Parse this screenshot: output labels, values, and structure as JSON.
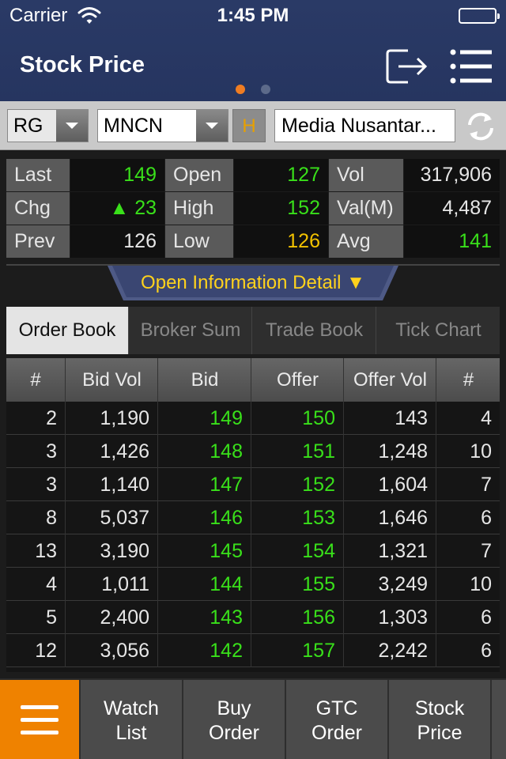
{
  "status_bar": {
    "carrier": "Carrier",
    "time": "1:45 PM"
  },
  "header": {
    "title": "Stock Price",
    "logout_icon": "logout-icon",
    "menu_icon": "list-menu-icon"
  },
  "page_indicator": {
    "active_color": "#f07d22",
    "inactive_color": "#5c6a8a"
  },
  "selector": {
    "board": "RG",
    "stock_code": "MNCN",
    "h_label": "H",
    "stock_name": "Media Nusantar...",
    "refresh_icon": "refresh-icon"
  },
  "quote": {
    "last_label": "Last",
    "last_value": "149",
    "chg_label": "Chg",
    "chg_value": "▲ 23",
    "prev_label": "Prev",
    "prev_value": "126",
    "open_label": "Open",
    "open_value": "127",
    "high_label": "High",
    "high_value": "152",
    "low_label": "Low",
    "low_value": "126",
    "vol_label": "Vol",
    "vol_value": "317,906",
    "valm_label": "Val(M)",
    "valm_value": "4,487",
    "avg_label": "Avg",
    "avg_value": "141"
  },
  "info_toggle": {
    "label": "Open Information Detail ▼"
  },
  "tabs": [
    {
      "label": "Order Book",
      "active": true
    },
    {
      "label": "Broker Sum",
      "active": false
    },
    {
      "label": "Trade Book",
      "active": false
    },
    {
      "label": "Tick Chart",
      "active": false
    }
  ],
  "order_book": {
    "headers": [
      "#",
      "Bid Vol",
      "Bid",
      "Offer",
      "Offer Vol",
      "#"
    ],
    "rows": [
      [
        "2",
        "1,190",
        "149",
        "150",
        "143",
        "4"
      ],
      [
        "3",
        "1,426",
        "148",
        "151",
        "1,248",
        "10"
      ],
      [
        "3",
        "1,140",
        "147",
        "152",
        "1,604",
        "7"
      ],
      [
        "8",
        "5,037",
        "146",
        "153",
        "1,646",
        "6"
      ],
      [
        "13",
        "3,190",
        "145",
        "154",
        "1,321",
        "7"
      ],
      [
        "4",
        "1,011",
        "144",
        "155",
        "3,249",
        "10"
      ],
      [
        "5",
        "2,400",
        "143",
        "156",
        "1,303",
        "6"
      ],
      [
        "12",
        "3,056",
        "142",
        "157",
        "2,242",
        "6"
      ]
    ]
  },
  "bottom_nav": {
    "menu_icon": "hamburger-icon",
    "items": [
      {
        "line1": "Watch",
        "line2": "List"
      },
      {
        "line1": "Buy",
        "line2": "Order"
      },
      {
        "line1": "GTC",
        "line2": "Order"
      },
      {
        "line1": "Stock",
        "line2": "Price"
      }
    ]
  },
  "colors": {
    "up": "#39e01a",
    "neutral": "#f2c200",
    "accent": "#ef8200",
    "header_bg": "#283763"
  }
}
